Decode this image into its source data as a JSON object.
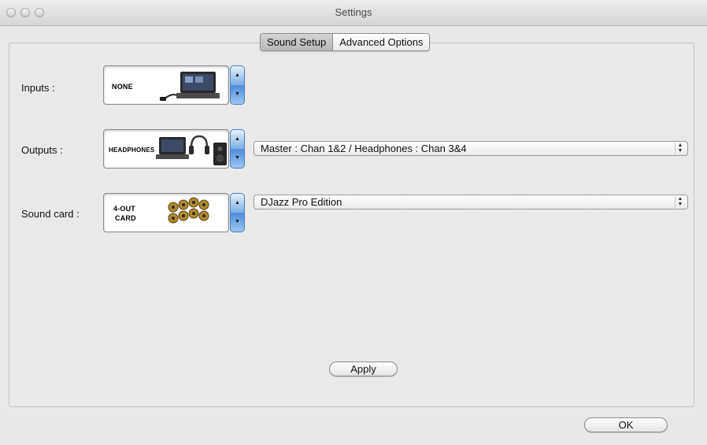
{
  "window": {
    "title": "Settings"
  },
  "tabs": [
    {
      "label": "Sound Setup",
      "selected": true
    },
    {
      "label": "Advanced Options",
      "selected": false
    }
  ],
  "inputs": {
    "label": "Inputs :",
    "picker_text": "NONE"
  },
  "outputs": {
    "label": "Outputs :",
    "picker_text": "HEADPHONES",
    "select_value": "Master : Chan 1&2 / Headphones : Chan 3&4"
  },
  "sound_card": {
    "label": "Sound card :",
    "picker_text_line1": "4-OUT",
    "picker_text_line2": "CARD",
    "select_value": "DJazz Pro Edition"
  },
  "apply_button": {
    "label": "Apply"
  },
  "ok_button": {
    "label": "OK"
  },
  "icons": {
    "stepper_up": "▲",
    "stepper_down": "▼",
    "select_arrows": "⬍"
  },
  "colors": {
    "stepper_blue": "#4e8ddb",
    "panel": "#e9e9e9"
  }
}
